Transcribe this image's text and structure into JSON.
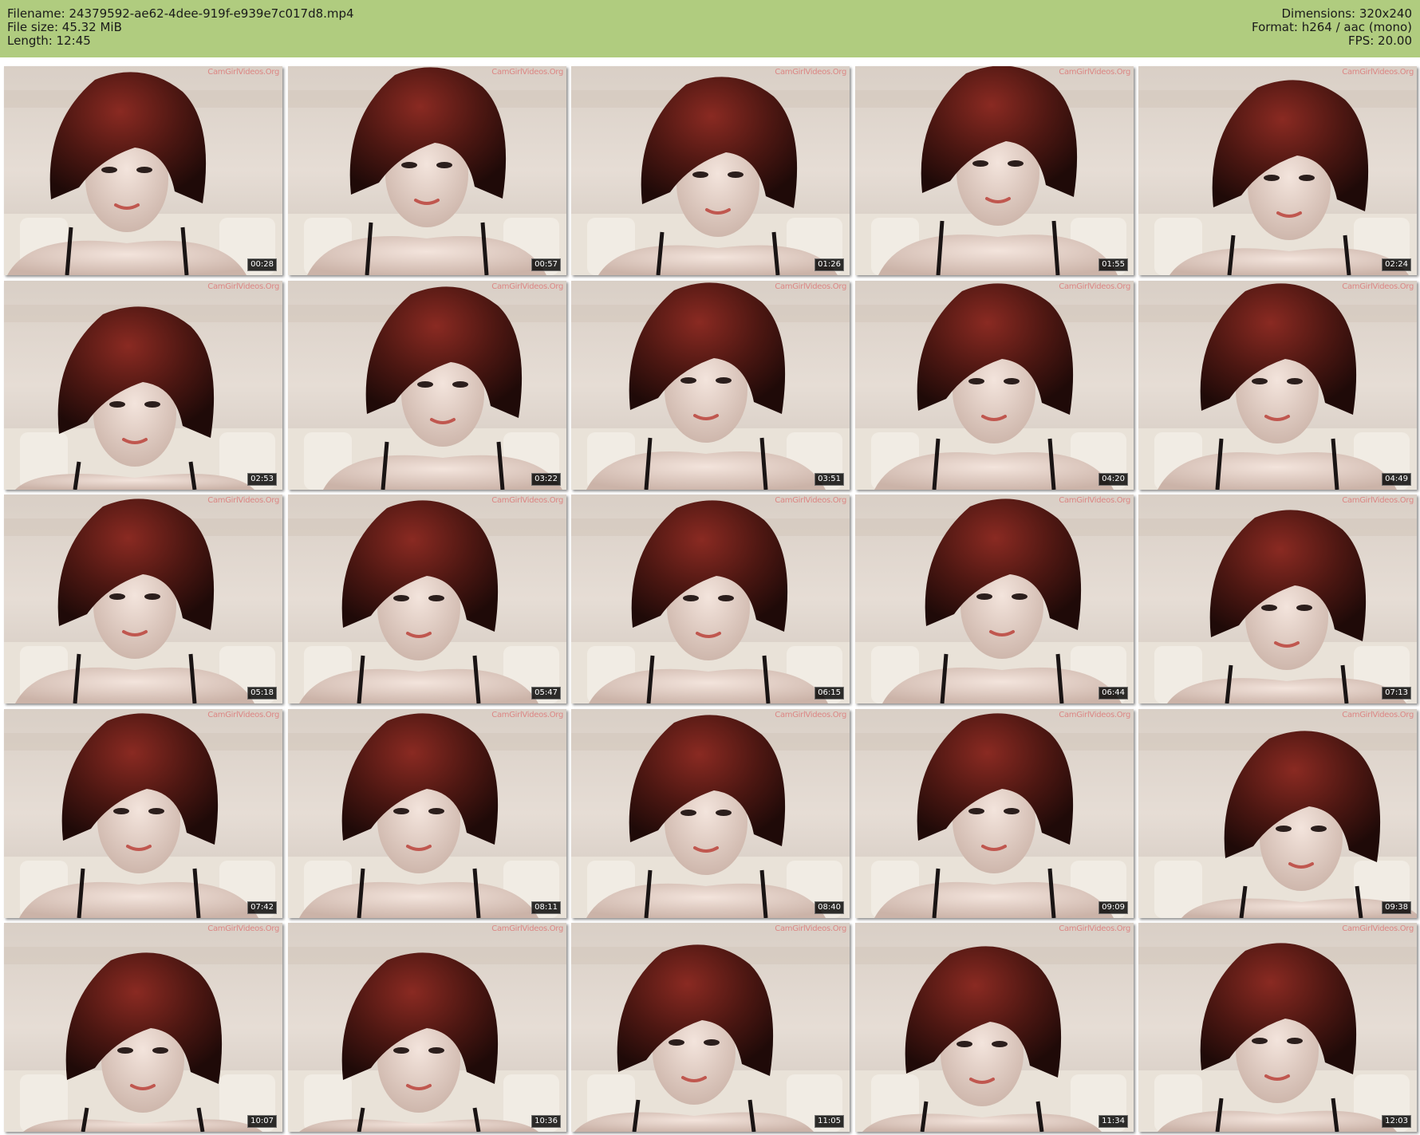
{
  "header": {
    "filename_line": "Filename: 24379592-ae62-4dee-919f-e939e7c017d8.mp4",
    "filesize_line": "File size: 45.32 MiB",
    "length_line": "Length: 12:45",
    "dimensions_line": "Dimensions: 320x240",
    "format_line": "Format: h264 / aac (mono)",
    "fps_line": "FPS: 20.00",
    "background_color": "#b0cc7f"
  },
  "thumbnails": {
    "watermark": "CamGirlVideos.Org",
    "columns": 5,
    "rows": 5,
    "timestamps": [
      "00:28",
      "00:57",
      "01:26",
      "01:55",
      "02:24",
      "02:53",
      "03:22",
      "03:51",
      "04:20",
      "04:49",
      "05:18",
      "05:47",
      "06:15",
      "06:44",
      "07:13",
      "07:42",
      "08:11",
      "08:40",
      "09:09",
      "09:38",
      "10:07",
      "10:36",
      "11:05",
      "11:34",
      "12:03"
    ]
  }
}
